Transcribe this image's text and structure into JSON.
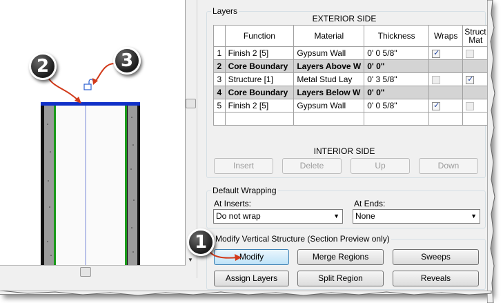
{
  "layers": {
    "group_title": "Layers",
    "exterior_label": "EXTERIOR SIDE",
    "interior_label": "INTERIOR SIDE",
    "columns": [
      "",
      "Function",
      "Material",
      "Thickness",
      "Wraps",
      "Struct Mat"
    ],
    "column_struct_line1": "Struct",
    "column_struct_line2": "Mat",
    "rows": [
      {
        "num": "1",
        "function": "Finish 2 [5]",
        "material": "Gypsum Wall",
        "thickness": "0'  0 5/8\"",
        "wraps": true,
        "structural": false,
        "core": false
      },
      {
        "num": "2",
        "function": "Core Boundary",
        "material": "Layers Above W",
        "thickness": "0'  0\"",
        "wraps": null,
        "structural": null,
        "core": true
      },
      {
        "num": "3",
        "function": "Structure [1]",
        "material": "Metal Stud Lay",
        "thickness": "0'  3 5/8\"",
        "wraps": false,
        "structural": true,
        "core": false
      },
      {
        "num": "4",
        "function": "Core Boundary",
        "material": "Layers Below W",
        "thickness": "0'  0\"",
        "wraps": null,
        "structural": null,
        "core": true
      },
      {
        "num": "5",
        "function": "Finish 2 [5]",
        "material": "Gypsum Wall",
        "thickness": "0'  0 5/8\"",
        "wraps": true,
        "structural": false,
        "core": false
      }
    ],
    "buttons": {
      "insert": "Insert",
      "delete": "Delete",
      "up": "Up",
      "down": "Down"
    }
  },
  "wrapping": {
    "group_title": "Default Wrapping",
    "at_inserts_label": "At Inserts:",
    "at_inserts_value": "Do not wrap",
    "at_ends_label": "At Ends:",
    "at_ends_value": "None"
  },
  "vertical": {
    "group_title": "Modify Vertical Structure (Section Preview only)",
    "buttons": {
      "modify": "Modify",
      "merge_regions": "Merge Regions",
      "sweeps": "Sweeps",
      "assign_layers": "Assign Layers",
      "split_region": "Split Region",
      "reveals": "Reveals"
    }
  },
  "callouts": {
    "one": "1",
    "two": "2",
    "three": "3"
  },
  "colors": {
    "core_boundary": "#1030c8",
    "structure_edge": "#1a9a1a",
    "callout_arrow": "#d23a1a"
  }
}
